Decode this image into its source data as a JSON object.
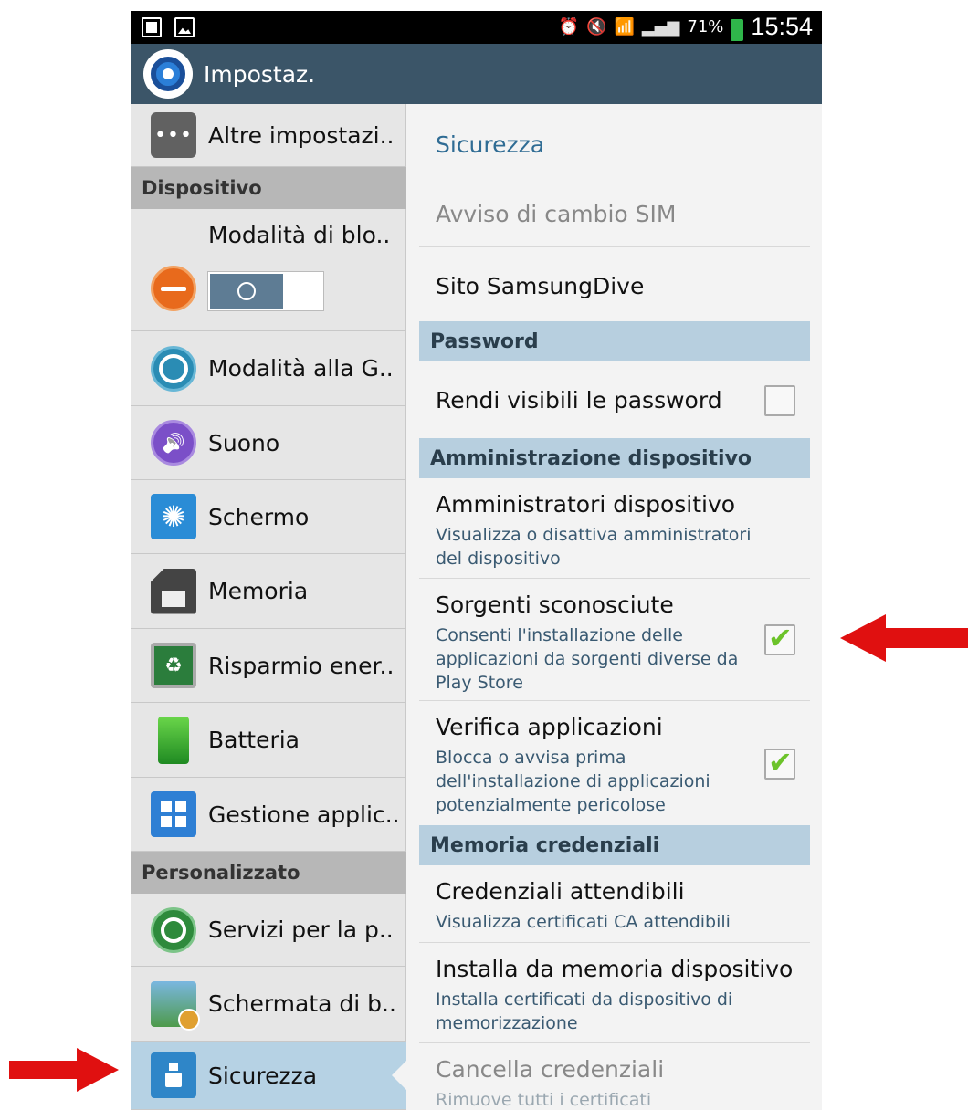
{
  "status_bar": {
    "icons": [
      "sim-icon",
      "image-icon",
      "alarm-icon",
      "mute-icon",
      "wifi-icon",
      "signal-icon",
      "battery-icon"
    ],
    "battery": "71%",
    "time": "15:54"
  },
  "action_bar": {
    "title": "Impostaz."
  },
  "sidebar": {
    "items": [
      {
        "label": "Altre impostazi..",
        "icon": "more-icon"
      },
      {
        "header": "Dispositivo"
      },
      {
        "label": "Modalità di blo..",
        "icon": "block-mode-icon",
        "toggle": "off"
      },
      {
        "label": "Modalità alla G..",
        "icon": "steering-wheel-icon"
      },
      {
        "label": "Suono",
        "icon": "speaker-icon"
      },
      {
        "label": "Schermo",
        "icon": "screen-brightness-icon"
      },
      {
        "label": "Memoria",
        "icon": "sd-card-icon"
      },
      {
        "label": "Risparmio ener..",
        "icon": "power-saving-icon"
      },
      {
        "label": "Batteria",
        "icon": "battery-icon"
      },
      {
        "label": "Gestione applic..",
        "icon": "apps-grid-icon"
      },
      {
        "header": "Personalizzato"
      },
      {
        "label": "Servizi per la p..",
        "icon": "location-icon"
      },
      {
        "label": "Schermata di b..",
        "icon": "lock-screen-icon"
      },
      {
        "label": "Sicurezza",
        "icon": "padlock-icon",
        "selected": true
      }
    ]
  },
  "detail": {
    "title": "Sicurezza",
    "rows": [
      {
        "title": "Avviso di cambio SIM",
        "disabled": true
      },
      {
        "title": "Sito SamsungDive"
      },
      {
        "header": "Password"
      },
      {
        "title": "Rendi visibili le password",
        "checkbox": false
      },
      {
        "header": "Amministrazione dispositivo"
      },
      {
        "title": "Amministratori dispositivo",
        "subtitle": "Visualizza o disattiva amministratori del dispositivo"
      },
      {
        "title": "Sorgenti sconosciute",
        "subtitle": "Consenti l'installazione delle applicazioni da sorgenti diverse da Play Store",
        "checkbox": true
      },
      {
        "title": "Verifica applicazioni",
        "subtitle": "Blocca o avvisa prima dell'installazione di applicazioni potenzialmente pericolose",
        "checkbox": true
      },
      {
        "header": "Memoria credenziali"
      },
      {
        "title": "Credenziali attendibili",
        "subtitle": "Visualizza certificati CA attendibili"
      },
      {
        "title": "Installa da memoria dispositivo",
        "subtitle": "Installa certificati da dispositivo di memorizzazione"
      },
      {
        "title": "Cancella credenziali",
        "subtitle": "Rimuove tutti i certificati",
        "disabled": true
      }
    ]
  },
  "colors": {
    "action_bar": "#3b5568",
    "section_header_right": "#b7cfdf",
    "section_header_left": "#b7b7b7",
    "selected_item": "#b6d2e4",
    "checkmark": "#6cc32a",
    "annotation_arrow": "#e01010"
  }
}
